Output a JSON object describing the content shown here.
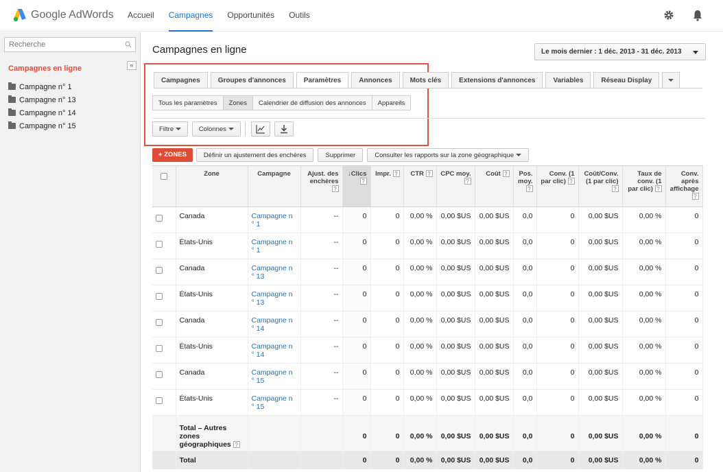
{
  "app": {
    "logo_text": "Google AdWords"
  },
  "nav": [
    "Accueil",
    "Campagnes",
    "Opportunités",
    "Outils"
  ],
  "sidebar": {
    "search_placeholder": "Recherche",
    "heading": "Campagnes en ligne",
    "collapse": "«",
    "items": [
      "Campagne n° 1",
      "Campagne n° 13",
      "Campagne n° 14",
      "Campagne n° 15"
    ]
  },
  "main": {
    "title": "Campagnes en ligne",
    "date_range": "Le mois dernier : 1 déc. 2013 - 31 déc. 2013",
    "tabs": [
      "Campagnes",
      "Groupes d'annonces",
      "Paramètres",
      "Annonces",
      "Mots clés",
      "Extensions d'annonces",
      "Variables",
      "Réseau Display"
    ],
    "active_tab": "Paramètres",
    "subtabs": [
      "Tous les paramètres",
      "Zones",
      "Calendrier de diffusion des annonces",
      "Appareils"
    ],
    "active_subtab": "Zones",
    "toolbar": {
      "filter": "Filtre",
      "columns": "Colonnes"
    },
    "actions": {
      "add_zones": "ZONES",
      "adjust_bids": "Définir un ajustement des enchères",
      "delete": "Supprimer",
      "reports": "Consulter les rapports sur la zone géographique"
    }
  },
  "table": {
    "headers": {
      "zone": "Zone",
      "campaign": "Campagne",
      "bid_adj": "Ajust. des enchères",
      "clicks": "Clics",
      "impr": "Impr.",
      "ctr": "CTR",
      "cpc": "CPC moy.",
      "cost": "Coût",
      "pos": "Pos. moy.",
      "conv": "Conv. (1 par clic)",
      "cost_conv": "Coût/Conv. (1 par clic)",
      "conv_rate": "Taux de conv. (1 par clic)",
      "view_conv": "Conv. après affichage"
    },
    "rows": [
      {
        "zone": "Canada",
        "campaign": "Campagne n ° 1",
        "bid_adj": "--",
        "clicks": "0",
        "impr": "0",
        "ctr": "0,00 %",
        "cpc": "0,00 $US",
        "cost": "0,00 $US",
        "pos": "0,0",
        "conv": "0",
        "cost_conv": "0,00 $US",
        "conv_rate": "0,00 %",
        "view_conv": "0"
      },
      {
        "zone": "États-Unis",
        "campaign": "Campagne n ° 1",
        "bid_adj": "--",
        "clicks": "0",
        "impr": "0",
        "ctr": "0,00 %",
        "cpc": "0,00 $US",
        "cost": "0,00 $US",
        "pos": "0,0",
        "conv": "0",
        "cost_conv": "0,00 $US",
        "conv_rate": "0,00 %",
        "view_conv": "0"
      },
      {
        "zone": "Canada",
        "campaign": "Campagne n ° 13",
        "bid_adj": "--",
        "clicks": "0",
        "impr": "0",
        "ctr": "0,00 %",
        "cpc": "0,00 $US",
        "cost": "0,00 $US",
        "pos": "0,0",
        "conv": "0",
        "cost_conv": "0,00 $US",
        "conv_rate": "0,00 %",
        "view_conv": "0"
      },
      {
        "zone": "États-Unis",
        "campaign": "Campagne n ° 13",
        "bid_adj": "--",
        "clicks": "0",
        "impr": "0",
        "ctr": "0,00 %",
        "cpc": "0,00 $US",
        "cost": "0,00 $US",
        "pos": "0,0",
        "conv": "0",
        "cost_conv": "0,00 $US",
        "conv_rate": "0,00 %",
        "view_conv": "0"
      },
      {
        "zone": "Canada",
        "campaign": "Campagne n ° 14",
        "bid_adj": "--",
        "clicks": "0",
        "impr": "0",
        "ctr": "0,00 %",
        "cpc": "0,00 $US",
        "cost": "0,00 $US",
        "pos": "0,0",
        "conv": "0",
        "cost_conv": "0,00 $US",
        "conv_rate": "0,00 %",
        "view_conv": "0"
      },
      {
        "zone": "États-Unis",
        "campaign": "Campagne n ° 14",
        "bid_adj": "--",
        "clicks": "0",
        "impr": "0",
        "ctr": "0,00 %",
        "cpc": "0,00 $US",
        "cost": "0,00 $US",
        "pos": "0,0",
        "conv": "0",
        "cost_conv": "0,00 $US",
        "conv_rate": "0,00 %",
        "view_conv": "0"
      },
      {
        "zone": "Canada",
        "campaign": "Campagne n ° 15",
        "bid_adj": "--",
        "clicks": "0",
        "impr": "0",
        "ctr": "0,00 %",
        "cpc": "0,00 $US",
        "cost": "0,00 $US",
        "pos": "0,0",
        "conv": "0",
        "cost_conv": "0,00 $US",
        "conv_rate": "0,00 %",
        "view_conv": "0"
      },
      {
        "zone": "États-Unis",
        "campaign": "Campagne n ° 15",
        "bid_adj": "--",
        "clicks": "0",
        "impr": "0",
        "ctr": "0,00 %",
        "cpc": "0,00 $US",
        "cost": "0,00 $US",
        "pos": "0,0",
        "conv": "0",
        "cost_conv": "0,00 $US",
        "conv_rate": "0,00 %",
        "view_conv": "0"
      }
    ],
    "total_other": {
      "label": "Total – Autres zones géographiques",
      "clicks": "0",
      "impr": "0",
      "ctr": "0,00 %",
      "cpc": "0,00 $US",
      "cost": "0,00 $US",
      "pos": "0,0",
      "conv": "0",
      "cost_conv": "0,00 $US",
      "conv_rate": "0,00 %",
      "view_conv": "0"
    },
    "total": {
      "label": "Total",
      "clicks": "0",
      "impr": "0",
      "ctr": "0,00 %",
      "cpc": "0,00 $US",
      "cost": "0,00 $US",
      "pos": "0,0",
      "conv": "0",
      "cost_conv": "0,00 $US",
      "conv_rate": "0,00 %",
      "view_conv": "0"
    }
  },
  "colors": {
    "accent": "#1a73c8",
    "red": "#dd4b39"
  }
}
